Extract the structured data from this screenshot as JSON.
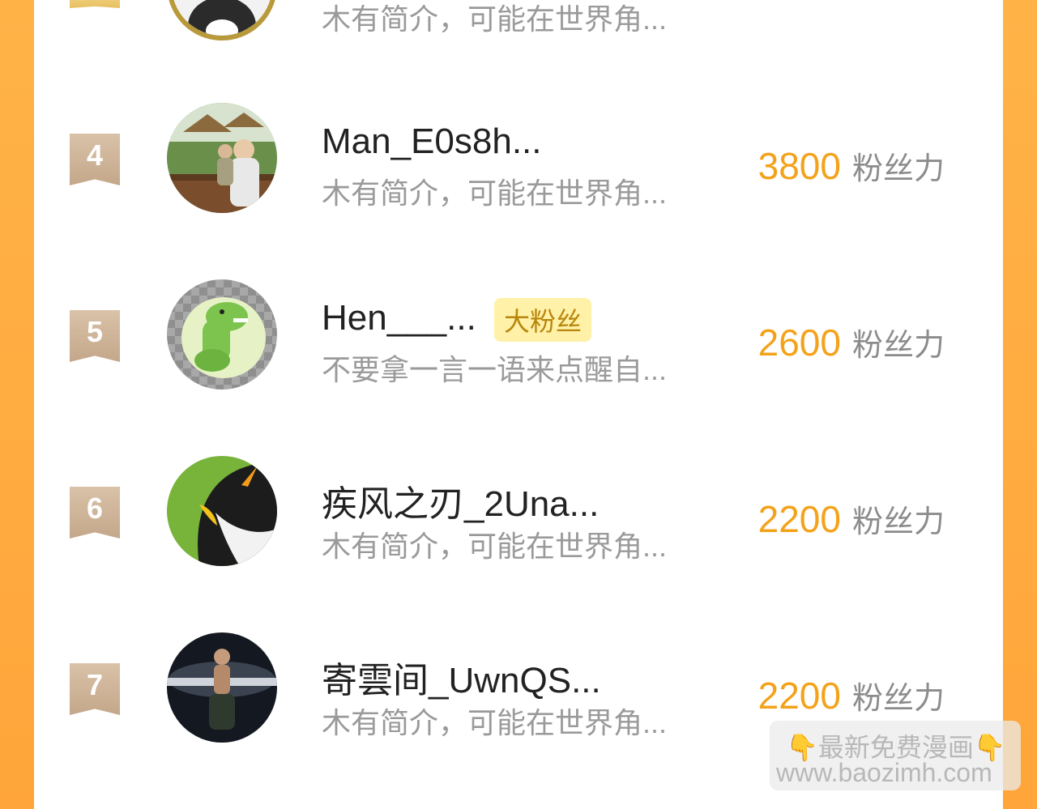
{
  "rows": [
    {
      "rank": "",
      "name": "",
      "bio": "木有简介，可能在世界角...",
      "score": "",
      "unit": "粉丝力"
    },
    {
      "rank": "4",
      "name": "Man_E0s8h...",
      "bio": "木有简介，可能在世界角...",
      "score": "3800",
      "unit": "粉丝力"
    },
    {
      "rank": "5",
      "name": "Hen___...",
      "badge": "大粉丝",
      "bio": "不要拿一言一语来点醒自...",
      "score": "2600",
      "unit": "粉丝力"
    },
    {
      "rank": "6",
      "name": "疾风之刃_2Una...",
      "bio": "木有简介，可能在世界角...",
      "score": "2200",
      "unit": "粉丝力"
    },
    {
      "rank": "7",
      "name": "寄雲间_UwnQS...",
      "bio": "木有简介，可能在世界角...",
      "score": "2200",
      "unit": "粉丝力"
    }
  ],
  "watermark": {
    "line1": "👇最新免费漫画👇",
    "line2": "www.baozimh.com"
  },
  "colors": {
    "accent": "#f4a21a",
    "rank_badge": "#c9ae90",
    "background": "#ffa53a"
  }
}
